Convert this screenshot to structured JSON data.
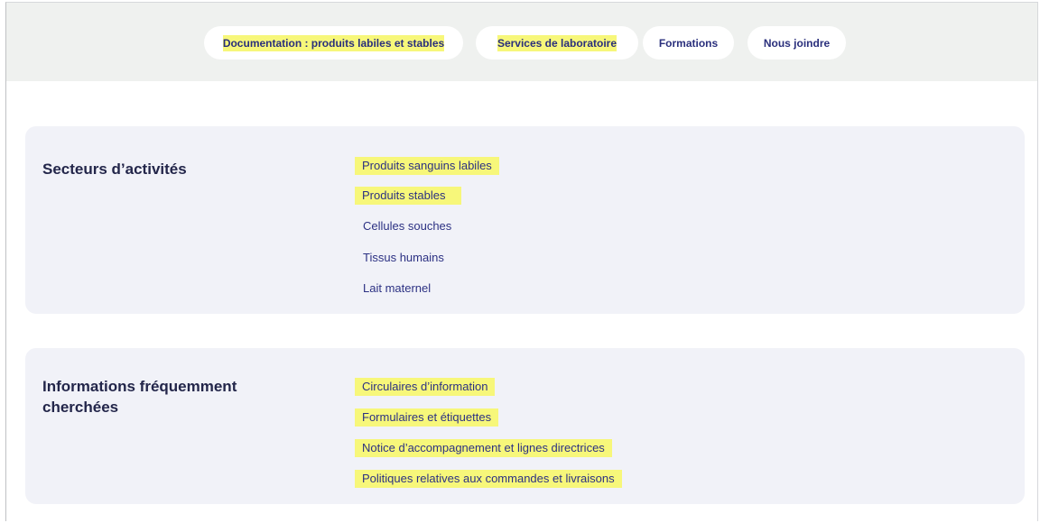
{
  "top_nav": {
    "items": [
      {
        "label": "Documentation : produits labiles et stables",
        "highlighted": true
      },
      {
        "label": "Services de laboratoire",
        "highlighted": true
      },
      {
        "label": "Formations",
        "highlighted": false
      },
      {
        "label": "Nous joindre",
        "highlighted": false
      }
    ]
  },
  "sections": [
    {
      "title": "Secteurs d’activités",
      "links": [
        {
          "label": "Produits sanguins labiles",
          "highlighted": true
        },
        {
          "label": "Produits stables",
          "highlighted": true
        },
        {
          "label": "Cellules souches",
          "highlighted": false
        },
        {
          "label": "Tissus humains",
          "highlighted": false
        },
        {
          "label": "Lait maternel",
          "highlighted": false
        }
      ]
    },
    {
      "title": "Informations fréquemment cherchées",
      "links": [
        {
          "label": "Circulaires d’information",
          "highlighted": true
        },
        {
          "label": "Formulaires et étiquettes",
          "highlighted": true
        },
        {
          "label": "Notice d’accompagnement et lignes directrices",
          "highlighted": true
        },
        {
          "label": "Politiques relatives aux commandes et livraisons",
          "highlighted": true
        }
      ]
    }
  ],
  "colors": {
    "header_bg": "#eff1ef",
    "card_bg": "#f1f2f8",
    "link": "#2c3183",
    "heading": "#23264a",
    "highlight": "#f7f77a"
  }
}
